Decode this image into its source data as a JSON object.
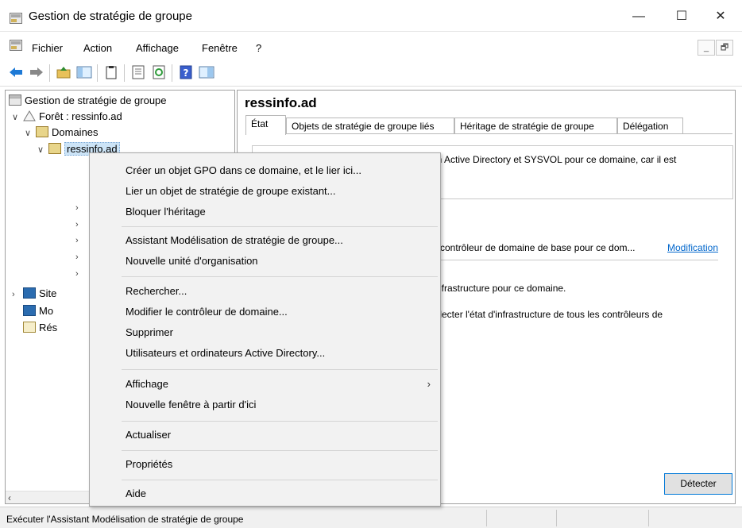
{
  "window": {
    "title": "Gestion de stratégie de groupe",
    "minimize": "—",
    "maximize": "☐",
    "close": "✕"
  },
  "menubar": {
    "items": [
      "Fichier",
      "Action",
      "Affichage",
      "Fenêtre",
      "?"
    ],
    "mdi_min": "_",
    "mdi_restore": "🗗"
  },
  "toolbar": {
    "icons": [
      "back-arrow-icon",
      "forward-arrow-icon",
      "up-folder-icon",
      "show-hide-tree-icon",
      "clipboard-icon",
      "properties-icon",
      "refresh-icon",
      "help-icon",
      "console-tree-icon"
    ]
  },
  "tree": {
    "root": "Gestion de stratégie de groupe",
    "forest": "Forêt : ressinfo.ad",
    "domains": "Domaines",
    "domain": "ressinfo.ad",
    "sites": "Site",
    "modeling": "Mo",
    "results": "Rés"
  },
  "right": {
    "title": "ressinfo.ad",
    "tabs": [
      "État",
      "Objets de stratégie de groupe liés",
      "Héritage de stratégie de groupe",
      "Délégation"
    ],
    "line1": "on Active Directory et SYSVOL pour ce domaine, car il est",
    "line2": "e contrôleur de domaine de base pour ce dom...",
    "modify_link": "Modification",
    "line3": "'infrastructure pour ce domaine.",
    "line4": "ollecter l'état d'infrastructure de tous les contrôleurs de",
    "detect_button": "Détecter"
  },
  "context_menu": {
    "items": [
      "Créer un objet GPO dans ce domaine, et le lier ici...",
      "Lier un objet de stratégie de groupe existant...",
      "Bloquer l'héritage",
      "Assistant Modélisation de stratégie de groupe...",
      "Nouvelle unité d'organisation",
      "Rechercher...",
      "Modifier le contrôleur de domaine...",
      "Supprimer",
      "Utilisateurs et ordinateurs Active Directory...",
      "Affichage",
      "Nouvelle fenêtre à partir d'ici",
      "Actualiser",
      "Propriétés",
      "Aide"
    ],
    "submenu_arrow": "›"
  },
  "status": {
    "text": "Exécuter l'Assistant Modélisation de stratégie de groupe"
  }
}
